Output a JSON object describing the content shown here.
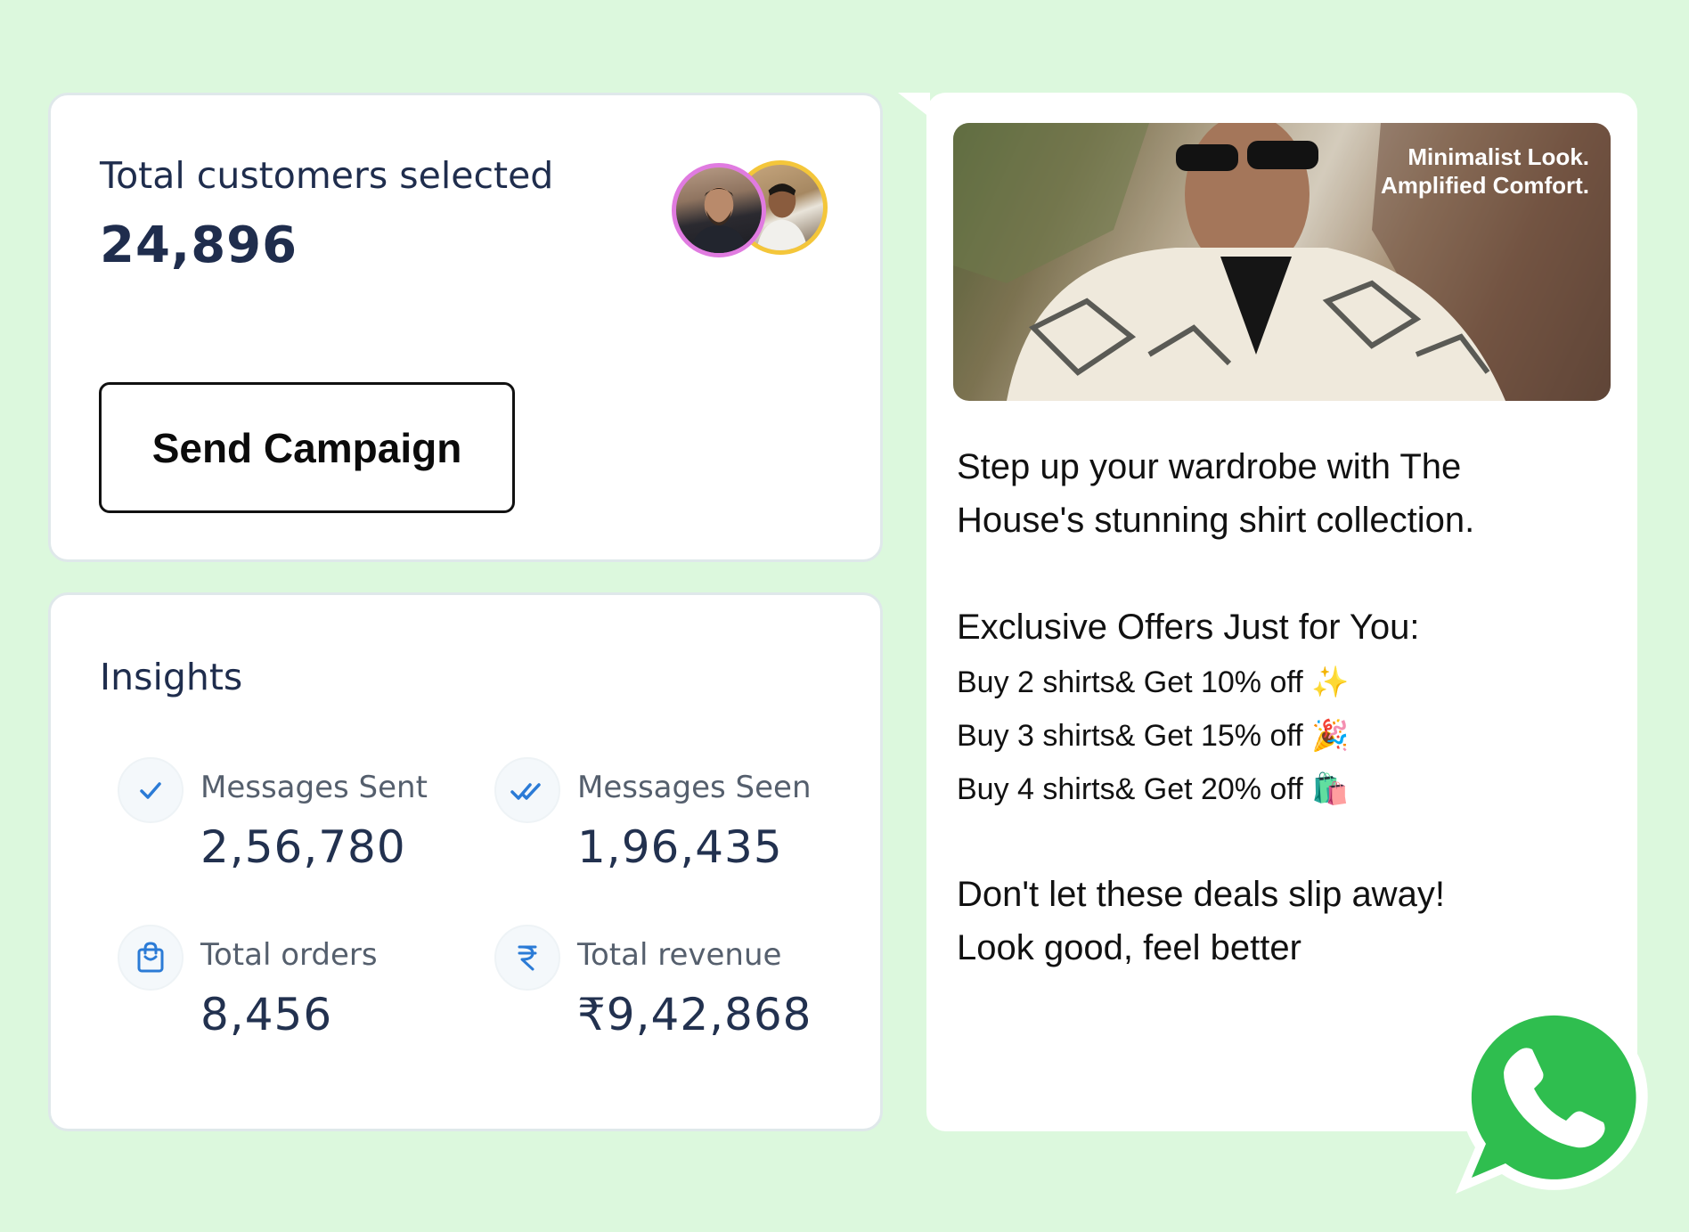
{
  "customers_card": {
    "title": "Total customers selected",
    "count": "24,896",
    "send_button_label": "Send Campaign"
  },
  "insights": {
    "title": "Insights",
    "metrics": [
      {
        "label": "Messages Sent",
        "value": "2,56,780",
        "icon": "check-icon"
      },
      {
        "label": "Messages Seen",
        "value": "1,96,435",
        "icon": "double-check-icon"
      },
      {
        "label": "Total orders",
        "value": "8,456",
        "icon": "shopping-bag-icon"
      },
      {
        "label": "Total revenue",
        "value": "₹9,42,868",
        "icon": "rupee-icon"
      }
    ]
  },
  "message": {
    "image_caption_line1": "Minimalist Look.",
    "image_caption_line2": "Amplified Comfort.",
    "intro_line1": "Step up your wardrobe with The",
    "intro_line2": "House's stunning shirt collection.",
    "offers_heading": "Exclusive Offers Just for You:",
    "offers": [
      "Buy 2 shirts&  Get 10% off ✨",
      "Buy 3 shirts& Get 15% off 🎉",
      "Buy 4 shirts& Get 20% off 🛍️"
    ],
    "closing_line1": "Don't let these deals slip away!",
    "closing_line2": "Look good, feel better"
  },
  "colors": {
    "background": "#dcf8dd",
    "accent_blue": "#2b7bd6",
    "whatsapp_green": "#25d366"
  }
}
